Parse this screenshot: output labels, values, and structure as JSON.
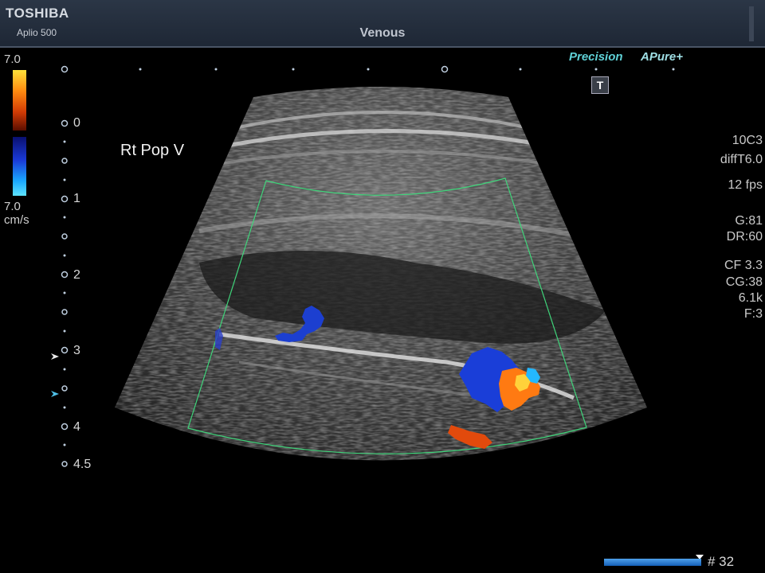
{
  "header": {
    "brand": "TOSHIBA",
    "model": "Aplio 500",
    "preset": "Venous"
  },
  "color_scale": {
    "max": "7.0",
    "min": "7.0",
    "unit": "cm/s"
  },
  "logos": {
    "precision": "Precision",
    "apure_a": "A",
    "apure_text": "Pure",
    "apure_plus": "+"
  },
  "t_button": "T",
  "annotation": "Rt Pop V",
  "depth_labels": [
    "0",
    "1",
    "2",
    "3",
    "4",
    "4.5"
  ],
  "params": {
    "probe": "10C3",
    "mode": "diffT6.0",
    "fps": "12 fps",
    "gain": "G:81",
    "dr": "DR:60",
    "cf": "CF 3.3",
    "cg": "CG:38",
    "prf": "6.1k",
    "filter": "F:3"
  },
  "frame_number": "# 32",
  "colors": {
    "header": "#2b3646",
    "roi_outline": "#3fd47a",
    "accent_logo": "#5fd0d6",
    "flow_red": "#ff6a10",
    "flow_blue": "#1a4adc"
  }
}
